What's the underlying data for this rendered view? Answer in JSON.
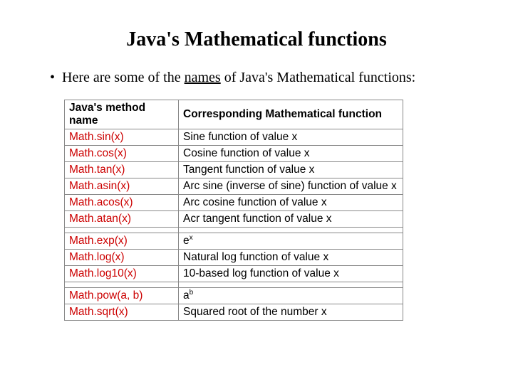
{
  "title": "Java's Mathematical functions",
  "intro_before": "Here are some of the ",
  "intro_underlined": "names",
  "intro_after": " of Java's Mathematical functions:",
  "headers": {
    "method": "Java's method name",
    "desc": "Corresponding Mathematical function"
  },
  "rows": {
    "r0": {
      "method": "Math.sin(x)",
      "desc": "Sine function of value x"
    },
    "r1": {
      "method": "Math.cos(x)",
      "desc": "Cosine function of value x"
    },
    "r2": {
      "method": "Math.tan(x)",
      "desc": "Tangent function of value x"
    },
    "r3": {
      "method": "Math.asin(x)",
      "desc": "Arc sine (inverse of sine) function of value x"
    },
    "r4": {
      "method": "Math.acos(x)",
      "desc": "Arc cosine function of value x"
    },
    "r5": {
      "method": "Math.atan(x)",
      "desc": "Acr tangent function of value x"
    },
    "r6": {
      "method": "Math.exp(x)",
      "desc_base": "e",
      "desc_sup": "x"
    },
    "r7": {
      "method": "Math.log(x)",
      "desc": "Natural log function of value x"
    },
    "r8": {
      "method": "Math.log10(x)",
      "desc": "10-based log function of value x"
    },
    "r9": {
      "method": "Math.pow(a, b)",
      "desc_base": "a",
      "desc_sup": "b"
    },
    "r10": {
      "method": "Math.sqrt(x)",
      "desc": "Squared root of the number x"
    }
  }
}
